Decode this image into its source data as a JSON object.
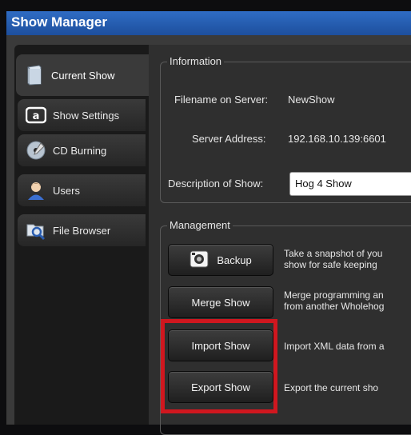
{
  "window": {
    "title": "Show Manager"
  },
  "tabs": [
    {
      "label": "Current Show",
      "icon": "book-icon"
    },
    {
      "label": "Show Settings",
      "icon": "settings-logo-icon"
    },
    {
      "label": "CD Burning",
      "icon": "cd-icon"
    },
    {
      "label": "Users",
      "icon": "user-icon"
    },
    {
      "label": "File Browser",
      "icon": "folder-search-icon"
    }
  ],
  "information": {
    "title": "Information",
    "filename_label": "Filename on Server:",
    "filename_value": "NewShow",
    "server_label": "Server Address:",
    "server_value": "192.168.10.139:6601",
    "description_label": "Description of Show:",
    "description_value": "Hog 4 Show"
  },
  "management": {
    "title": "Management",
    "buttons": [
      {
        "label": "Backup",
        "desc1": "Take a snapshot of you",
        "desc2": "show for safe keeping"
      },
      {
        "label": "Merge Show",
        "desc1": "Merge programming an",
        "desc2": "from another Wholehog"
      },
      {
        "label": "Import Show",
        "desc1": "Import XML data from a",
        "desc2": ""
      },
      {
        "label": "Export Show",
        "desc1": "Export the current sho",
        "desc2": ""
      }
    ]
  },
  "colors": {
    "title_bar": "#1d4f9d",
    "highlight": "#d0171f"
  }
}
